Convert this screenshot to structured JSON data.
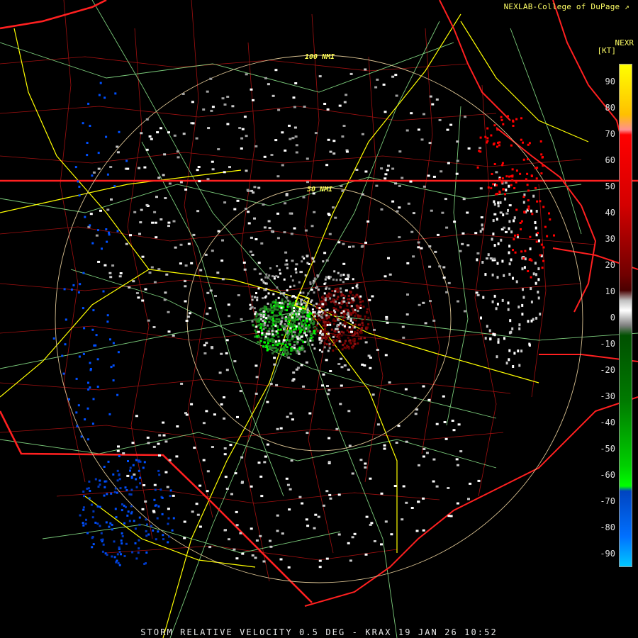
{
  "header": {
    "credit": "NEXLAB-College of DuPage",
    "credit_mark": "↗",
    "product_code": "NEXR",
    "units": "[KT]"
  },
  "range_rings": {
    "inner_label": "50 NMI",
    "outer_label": "100 NMI"
  },
  "color_scale": {
    "ticks": [
      "90",
      "80",
      "70",
      "60",
      "50",
      "40",
      "30",
      "20",
      "10",
      "0",
      "-10",
      "-20",
      "-30",
      "-40",
      "-50",
      "-60",
      "-70",
      "-80",
      "-90"
    ]
  },
  "footer": {
    "caption": "STORM RELATIVE VELOCITY 0.5 DEG - KRAX 19 JAN 26 10:52"
  },
  "colors": {
    "inbound_light": "#00ff00",
    "inbound_dark": "#1f8f1f",
    "outbound_dark": "#7a0000",
    "outbound_bright": "#ff0000",
    "range_folded": "#c8c8c8",
    "far_inbound": "#0050ff",
    "state_lines": "#ff2020",
    "county_lines": "#a01010",
    "highways": "#ffff00",
    "roads": "#90ee90"
  }
}
